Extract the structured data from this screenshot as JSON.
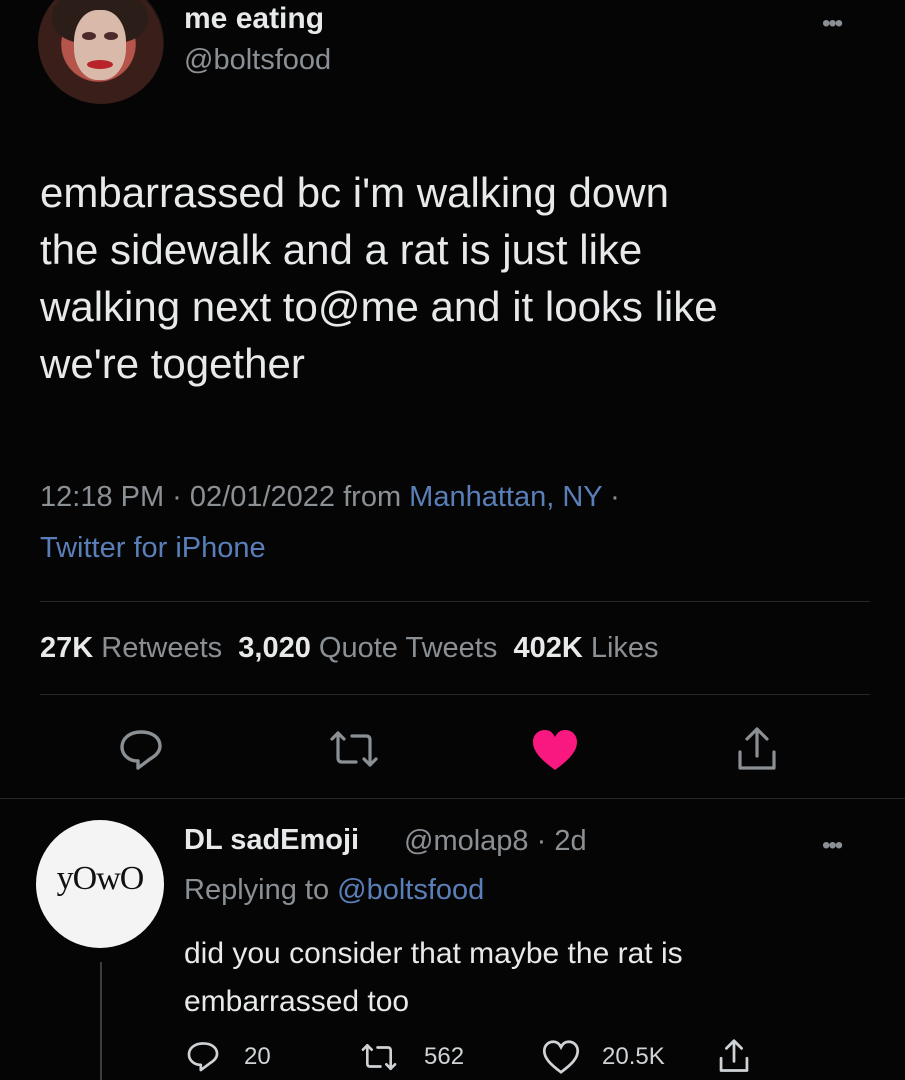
{
  "tweet": {
    "display_name": "me eating",
    "handle": "@boltsfood",
    "text": "embarrassed bc i'm walking down\nthe sidewalk and a rat is just like\nwalking next to@me and it looks like\nwe're together",
    "time": "12:18 PM · 02/01/2022 from ",
    "location": "Manhattan, NY",
    "location_sep": " ·",
    "source": "Twitter for iPhone",
    "stats": {
      "retweets_count": "27K",
      "retweets_label": "Retweets",
      "quotes_count": "3,020",
      "quotes_label": "Quote Tweets",
      "likes_count": "402K",
      "likes_label": "Likes"
    },
    "liked_color": "#f91880"
  },
  "reply": {
    "avatar_text": "yOwO",
    "display_name": "DL sadEmoji",
    "handle_time": "@molap8 · 2d",
    "replying_prefix": "Replying to ",
    "replying_handle": "@boltsfood",
    "text": "did you consider that maybe the rat is embarrassed too",
    "reply_count": "20",
    "retweet_count": "562",
    "like_count": "20.5K"
  },
  "icons": {
    "more": "more-dots-icon",
    "reply": "reply-icon",
    "retweet": "retweet-icon",
    "like": "heart-icon",
    "share": "share-icon"
  }
}
